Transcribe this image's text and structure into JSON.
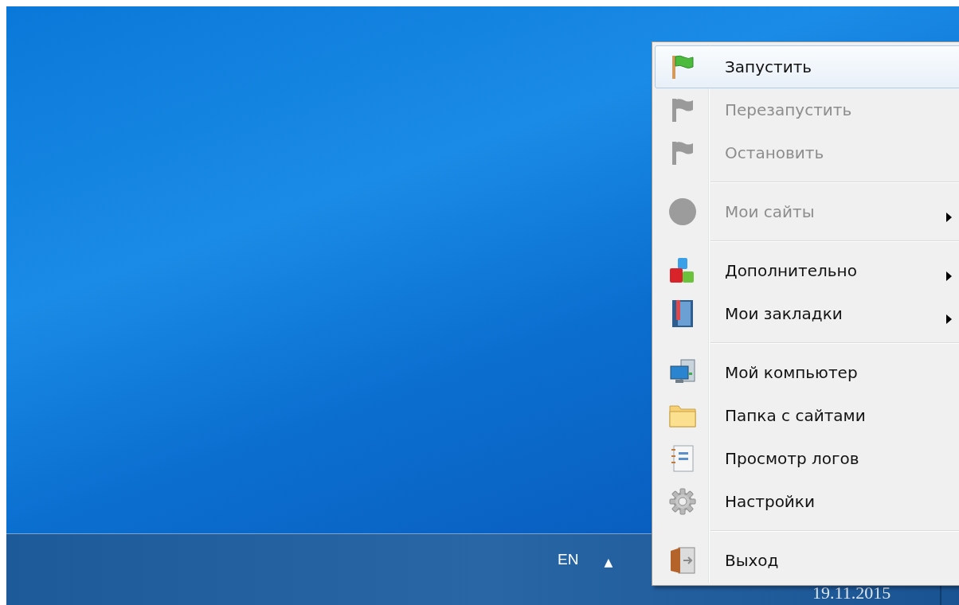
{
  "taskbar": {
    "language": "EN",
    "tray_arrow": "▲",
    "date": "19.11.2015"
  },
  "context_menu": {
    "items": [
      {
        "kind": "item",
        "label": "Запустить",
        "selected": true,
        "disabled": false,
        "submenu": false
      },
      {
        "kind": "item",
        "label": "Перезапустить",
        "selected": false,
        "disabled": true,
        "submenu": false
      },
      {
        "kind": "item",
        "label": "Остановить",
        "selected": false,
        "disabled": true,
        "submenu": false
      },
      {
        "kind": "separator"
      },
      {
        "kind": "item",
        "label": "Мои сайты",
        "selected": false,
        "disabled": true,
        "submenu": true
      },
      {
        "kind": "separator"
      },
      {
        "kind": "item",
        "label": "Дополнительно",
        "selected": false,
        "disabled": false,
        "submenu": true
      },
      {
        "kind": "item",
        "label": "Мои закладки",
        "selected": false,
        "disabled": false,
        "submenu": true
      },
      {
        "kind": "separator"
      },
      {
        "kind": "item",
        "label": "Мой компьютер",
        "selected": false,
        "disabled": false,
        "submenu": false
      },
      {
        "kind": "item",
        "label": "Папка с сайтами",
        "selected": false,
        "disabled": false,
        "submenu": false
      },
      {
        "kind": "item",
        "label": "Просмотр логов",
        "selected": false,
        "disabled": false,
        "submenu": false
      },
      {
        "kind": "item",
        "label": "Настройки",
        "selected": false,
        "disabled": false,
        "submenu": false
      },
      {
        "kind": "separator"
      },
      {
        "kind": "item",
        "label": "Выход",
        "selected": false,
        "disabled": false,
        "submenu": false
      }
    ]
  }
}
